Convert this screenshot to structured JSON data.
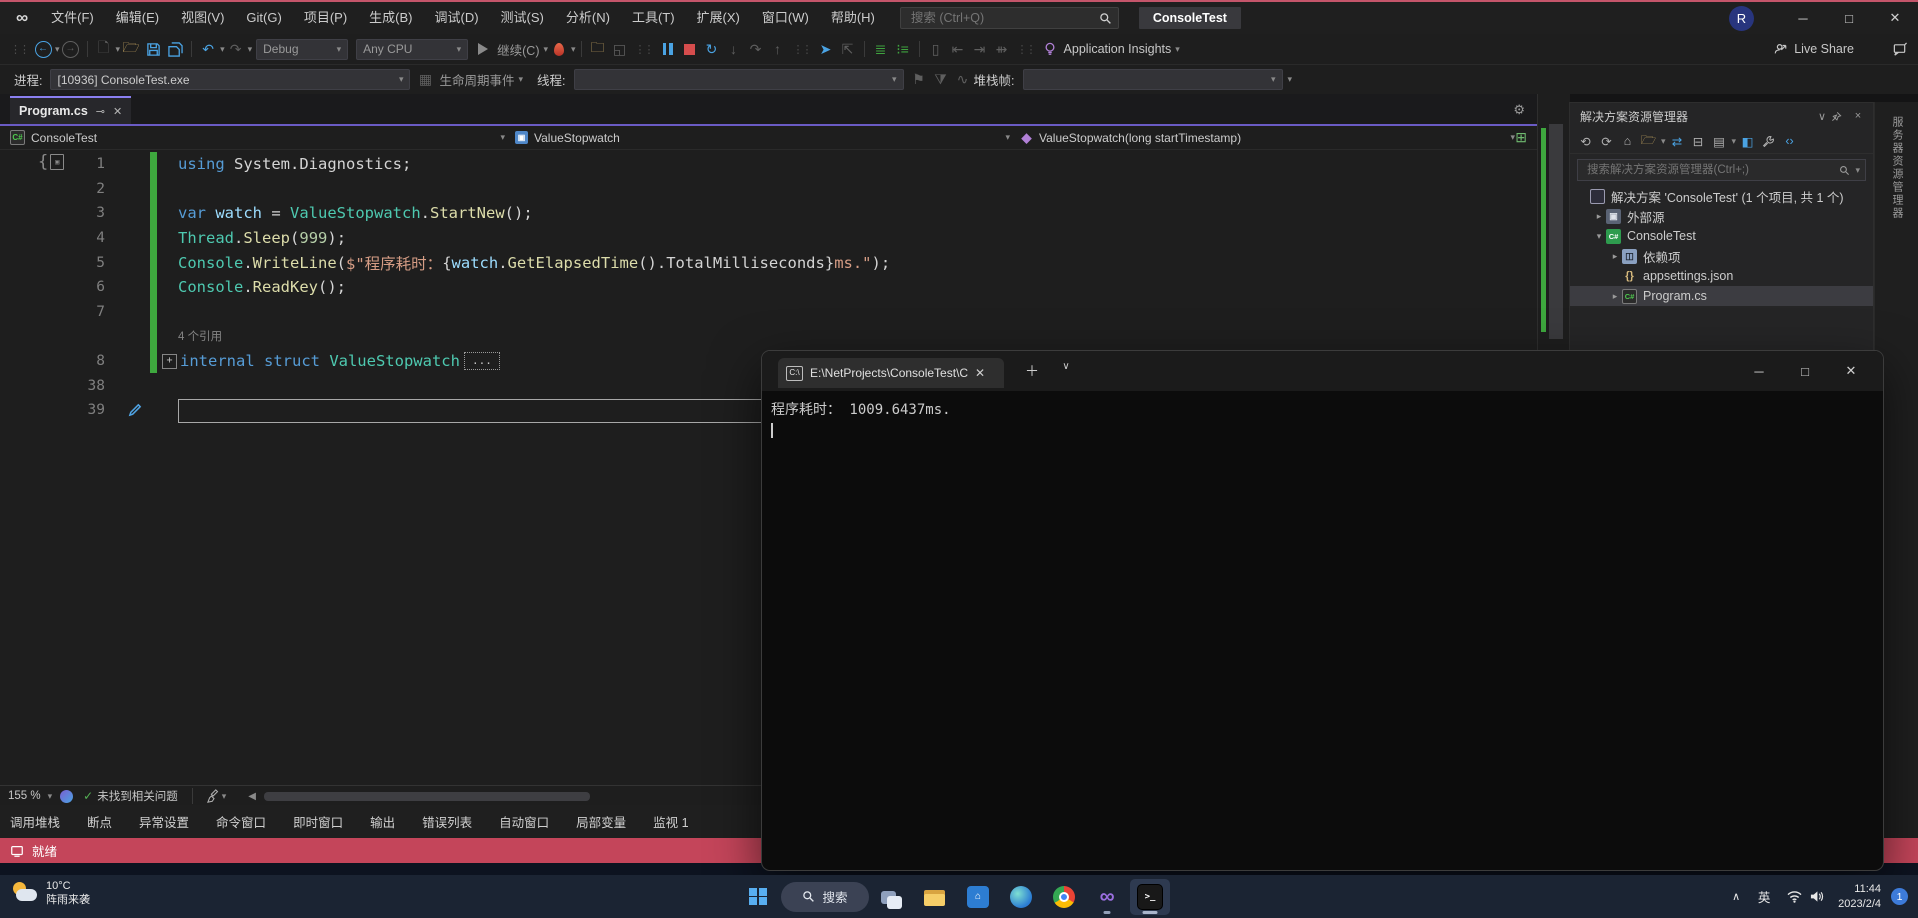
{
  "titlebar": {
    "menus": [
      "文件(F)",
      "编辑(E)",
      "视图(V)",
      "Git(G)",
      "项目(P)",
      "生成(B)",
      "调试(D)",
      "测试(S)",
      "分析(N)",
      "工具(T)",
      "扩展(X)",
      "窗口(W)",
      "帮助(H)"
    ],
    "search_placeholder": "搜索 (Ctrl+Q)",
    "solution_name": "ConsoleTest",
    "avatar_initial": "R"
  },
  "toolbar": {
    "configuration": "Debug",
    "platform": "Any CPU",
    "continue_label": "继续(C)",
    "app_insights": "Application Insights",
    "live_share": "Live Share"
  },
  "process_bar": {
    "process_label": "进程:",
    "process_value": "[10936] ConsoleTest.exe",
    "lifecycle": "生命周期事件",
    "thread_label": "线程:",
    "stack_frame_label": "堆栈帧:"
  },
  "editor": {
    "tab_title": "Program.cs",
    "breadcrumbs": [
      {
        "icon": "csfile",
        "label": "ConsoleTest"
      },
      {
        "icon": "struct",
        "label": "ValueStopwatch"
      },
      {
        "icon": "method",
        "label": "ValueStopwatch(long startTimestamp)"
      }
    ],
    "code_lines": [
      {
        "num": "1",
        "green": true,
        "seg": [
          {
            "c": "kw",
            "t": "using"
          },
          {
            "c": "pn",
            "t": " System.Diagnostics;"
          }
        ]
      },
      {
        "num": "2",
        "green": true,
        "seg": []
      },
      {
        "num": "3",
        "green": true,
        "seg": [
          {
            "c": "kw",
            "t": "var"
          },
          {
            "c": "pn",
            "t": " "
          },
          {
            "c": "va",
            "t": "watch"
          },
          {
            "c": "pn",
            "t": " = "
          },
          {
            "c": "ty",
            "t": "ValueStopwatch"
          },
          {
            "c": "pn",
            "t": "."
          },
          {
            "c": "me",
            "t": "StartNew"
          },
          {
            "c": "pn",
            "t": "();"
          }
        ]
      },
      {
        "num": "4",
        "green": true,
        "seg": [
          {
            "c": "ty",
            "t": "Thread"
          },
          {
            "c": "pn",
            "t": "."
          },
          {
            "c": "me",
            "t": "Sleep"
          },
          {
            "c": "pn",
            "t": "("
          },
          {
            "c": "nu",
            "t": "999"
          },
          {
            "c": "pn",
            "t": ");"
          }
        ]
      },
      {
        "num": "5",
        "green": true,
        "seg": [
          {
            "c": "ty",
            "t": "Console"
          },
          {
            "c": "pn",
            "t": "."
          },
          {
            "c": "me",
            "t": "WriteLine"
          },
          {
            "c": "pn",
            "t": "("
          },
          {
            "c": "st",
            "t": "$\"程序耗时："
          },
          {
            "c": "pn",
            "t": "{"
          },
          {
            "c": "va",
            "t": "watch"
          },
          {
            "c": "pn",
            "t": "."
          },
          {
            "c": "me",
            "t": "GetElapsedTime"
          },
          {
            "c": "pn",
            "t": "()."
          },
          {
            "c": "pn",
            "t": "TotalMilliseconds"
          },
          {
            "c": "pn",
            "t": "}"
          },
          {
            "c": "st",
            "t": "ms.\""
          },
          {
            "c": "pn",
            "t": ");"
          }
        ]
      },
      {
        "num": "6",
        "green": true,
        "seg": [
          {
            "c": "ty",
            "t": "Console"
          },
          {
            "c": "pn",
            "t": "."
          },
          {
            "c": "me",
            "t": "ReadKey"
          },
          {
            "c": "pn",
            "t": "();"
          }
        ]
      },
      {
        "num": "7",
        "green": true,
        "seg": []
      },
      {
        "num": "",
        "green": true,
        "lens": "4 个引用",
        "seg": []
      },
      {
        "num": "8",
        "green": true,
        "expander": true,
        "collapsed": "...",
        "seg": [
          {
            "c": "kw",
            "t": "internal struct "
          },
          {
            "c": "ty",
            "t": "ValueStopwatch"
          }
        ]
      },
      {
        "num": "38",
        "seg": []
      },
      {
        "num": "39",
        "tool": true,
        "box": true,
        "seg": []
      }
    ],
    "zoom_level": "155 %",
    "health_status": "未找到相关问题"
  },
  "panel_tabs": [
    "调用堆栈",
    "断点",
    "异常设置",
    "命令窗口",
    "即时窗口",
    "输出",
    "错误列表",
    "自动窗口",
    "局部变量",
    "监视 1"
  ],
  "status_bar": {
    "text": "就绪"
  },
  "solution_explorer": {
    "title": "解决方案资源管理器",
    "search_placeholder": "搜索解决方案资源管理器(Ctrl+;)",
    "tree": [
      {
        "indent": 0,
        "arrow": "",
        "icon": "solution",
        "glyph": "",
        "label": "解决方案 'ConsoleTest' (1 个项目, 共 1 个)"
      },
      {
        "indent": 1,
        "arrow": "▸",
        "icon": "external",
        "glyph": "▣",
        "label": "外部源"
      },
      {
        "indent": 1,
        "arrow": "▾",
        "icon": "project",
        "glyph": "C#",
        "label": "ConsoleTest"
      },
      {
        "indent": 2,
        "arrow": "▸",
        "icon": "deps",
        "glyph": "◫",
        "label": "依赖项"
      },
      {
        "indent": 2,
        "arrow": "",
        "icon": "json",
        "glyph": "{}",
        "label": "appsettings.json"
      },
      {
        "indent": 2,
        "arrow": "▸",
        "icon": "cs",
        "glyph": "C#",
        "label": "Program.cs",
        "selected": true
      }
    ]
  },
  "right_strip": {
    "vertical_tab": "服务器资源管理器"
  },
  "terminal": {
    "tab_title": "E:\\NetProjects\\ConsoleTest\\C",
    "output_line": "程序耗时： 1009.6437ms."
  },
  "taskbar": {
    "weather_temp": "10°C",
    "weather_desc": "阵雨来袭",
    "search_label": "搜索",
    "ime_label": "英",
    "time": "11:44",
    "date": "2023/2/4",
    "notification_count": "1"
  }
}
